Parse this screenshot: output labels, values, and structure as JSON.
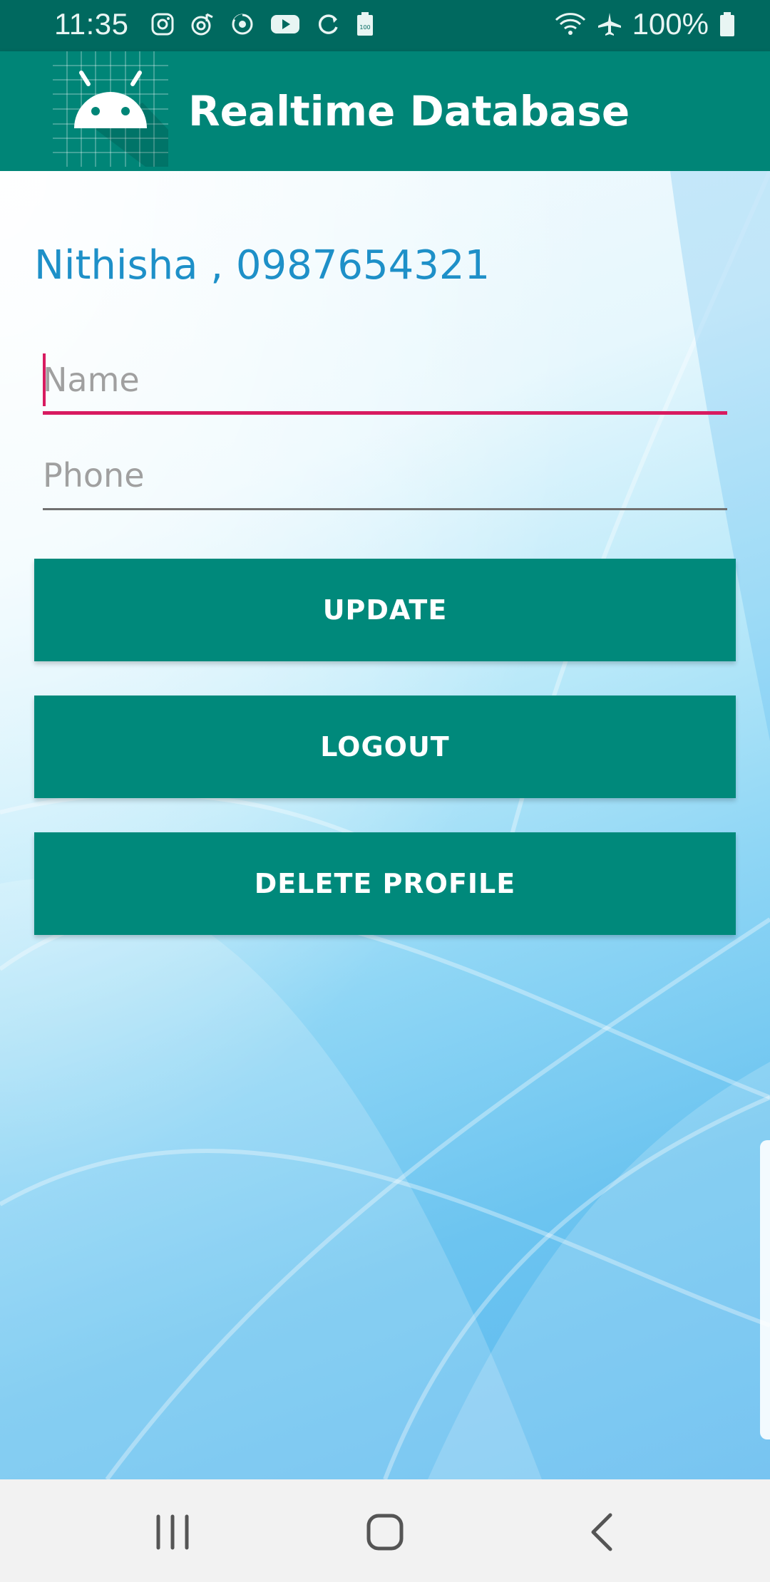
{
  "status_bar": {
    "time": "11:35",
    "battery_percent": "100%",
    "icons": [
      "instagram-icon",
      "music-icon",
      "sync-app-icon",
      "youtube-icon",
      "refresh-icon",
      "battery-saver-icon"
    ],
    "right_icons": [
      "wifi-icon",
      "airplane-mode-icon",
      "battery-icon"
    ]
  },
  "app_bar": {
    "title": "Realtime Database",
    "logo": "android-icon"
  },
  "profile": {
    "user_info": "Nithisha , 0987654321"
  },
  "form": {
    "name_placeholder": "Name",
    "name_value": "",
    "phone_placeholder": "Phone",
    "phone_value": ""
  },
  "buttons": {
    "update": "UPDATE",
    "logout": "LOGOUT",
    "delete_profile": "DELETE PROFILE"
  },
  "nav_bar": {
    "items": [
      "recent-apps-icon",
      "home-icon",
      "back-icon"
    ]
  },
  "colors": {
    "status_bar": "#00695f",
    "app_bar": "#008577",
    "button": "#00897b",
    "accent": "#d81b60",
    "user_text": "#1e90c8"
  }
}
